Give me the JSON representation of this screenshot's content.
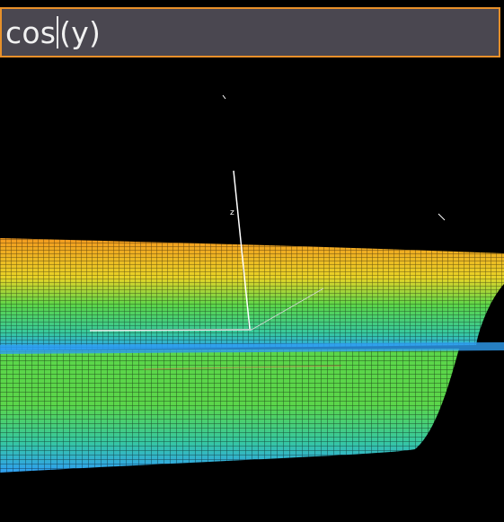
{
  "expression": {
    "before_caret": "cos",
    "after_caret": "(y)"
  },
  "plot": {
    "axis_label_z": "z",
    "surface_colors": [
      "#f39a1f",
      "#e8d327",
      "#5bd64a",
      "#36c8a0",
      "#2f9ff2"
    ],
    "highlight_color": "#ff4f4f",
    "grid_on": true
  }
}
